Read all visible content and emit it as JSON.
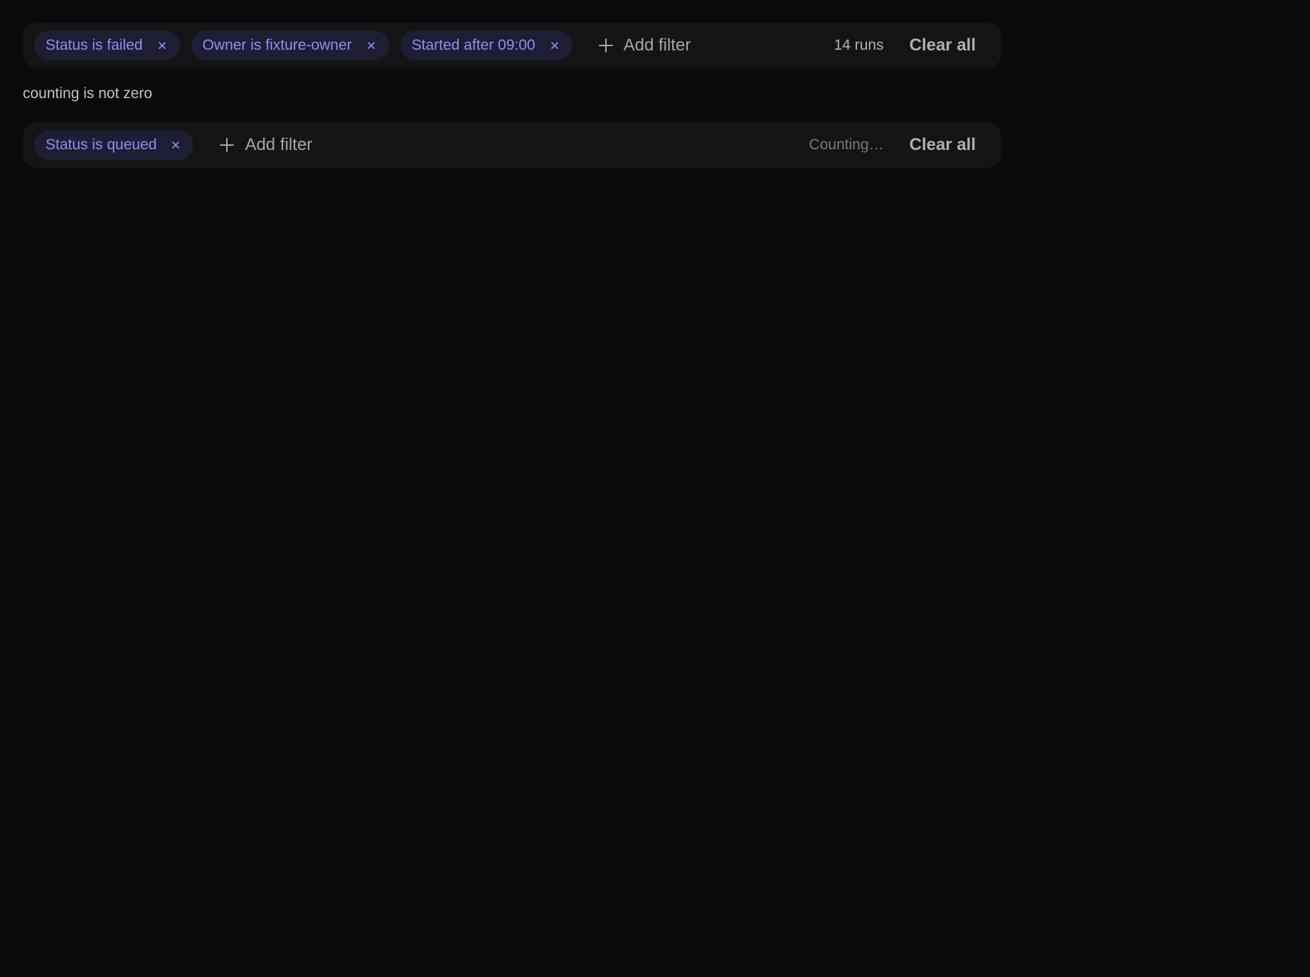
{
  "colors": {
    "background": "#0a0a0a",
    "bar_background": "#141414",
    "chip_background": "#1d1e33",
    "chip_text": "#8c8ff8",
    "muted_text": "#7a7a7a"
  },
  "icons": {
    "chip_remove": "close-icon",
    "add_filter": "plus-icon"
  },
  "filter_bars": [
    {
      "chips": [
        {
          "label": "Status is failed"
        },
        {
          "label": "Owner is fixture-owner"
        },
        {
          "label": "Started after 09:00"
        }
      ],
      "add_filter_label": "Add filter",
      "count_text": "14 runs",
      "clear_all_label": "Clear all"
    },
    {
      "chips": [
        {
          "label": "Status is queued"
        }
      ],
      "add_filter_label": "Add filter",
      "count_text": "Counting…",
      "clear_all_label": "Clear all"
    }
  ],
  "caption": "counting is not zero"
}
